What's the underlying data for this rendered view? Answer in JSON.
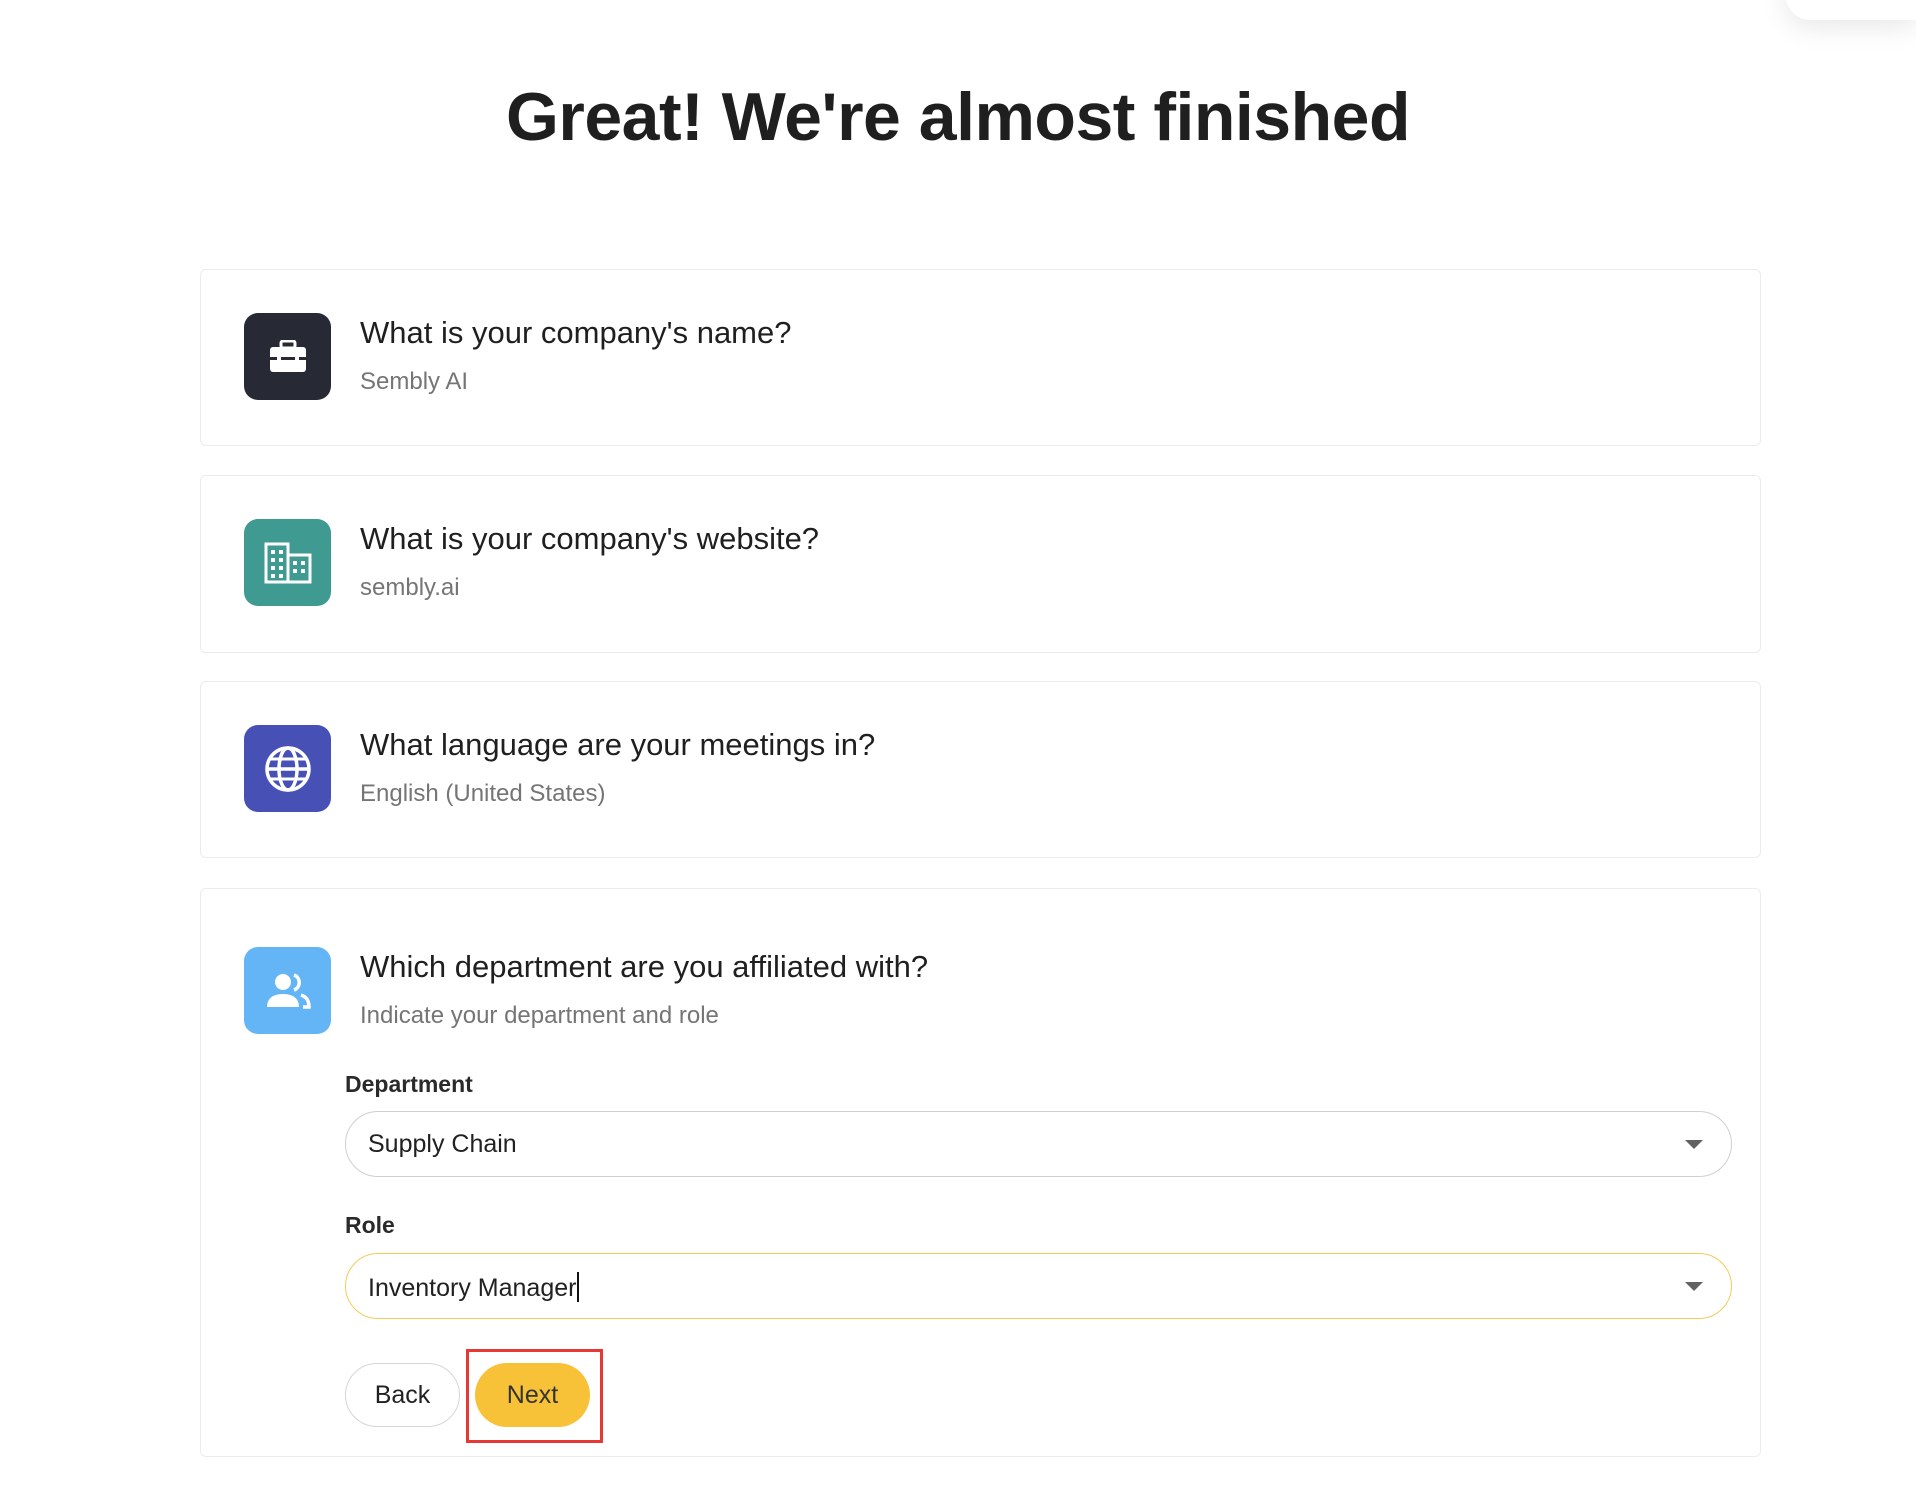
{
  "page": {
    "title": "Great! We're almost finished"
  },
  "questions": [
    {
      "icon": "briefcase-icon",
      "title": "What is your company's name?",
      "answer": "Sembly AI",
      "color": "#272a35"
    },
    {
      "icon": "building-icon",
      "title": "What is your company's website?",
      "answer": "sembly.ai",
      "color": "#3f9a91"
    },
    {
      "icon": "globe-icon",
      "title": "What language are your meetings in?",
      "answer": "English (United States)",
      "color": "#4650b5"
    },
    {
      "icon": "people-icon",
      "title": "Which department are you affiliated with?",
      "answer": "Indicate your department and role",
      "color": "#64b5f6"
    }
  ],
  "form": {
    "department_label": "Department",
    "department_value": "Supply Chain",
    "role_label": "Role",
    "role_value": "Inventory Manager"
  },
  "actions": {
    "back_label": "Back",
    "next_label": "Next"
  },
  "colors": {
    "accent": "#f7c237",
    "highlight": "#e53935",
    "focus_border": "#f2cc5a"
  }
}
